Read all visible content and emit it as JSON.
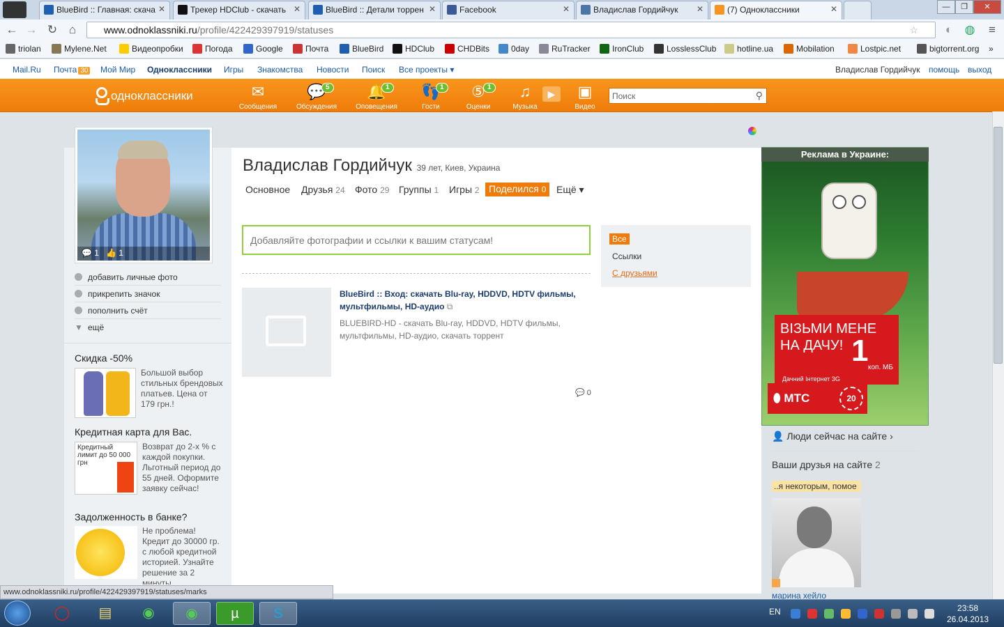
{
  "browser": {
    "tabs": [
      {
        "title": "BlueBird :: Главная: скача",
        "active": false
      },
      {
        "title": "Трекер HDClub - скачать",
        "active": false
      },
      {
        "title": "BlueBird :: Детали торрен",
        "active": false
      },
      {
        "title": "Facebook",
        "active": false
      },
      {
        "title": "Владислав Гордийчук",
        "active": false
      },
      {
        "title": "(7) Одноклассники",
        "active": true
      }
    ],
    "url_host": "www.odnoklassniki.ru",
    "url_path": "/profile/422429397919/statuses",
    "bookmarks": [
      "triolan",
      "Mylene.Net",
      "Видеопробки",
      "Погода",
      "Google",
      "Почта",
      "BlueBird",
      "HDClub",
      "CHDBits",
      "0day",
      "RuTracker",
      "IronClub",
      "LosslessClub",
      "hotline.ua",
      "Mobilation",
      "Lostpic.net",
      "bigtorrent.org"
    ],
    "status_url": "www.odnoklassniki.ru/profile/422429397919/statuses/marks"
  },
  "mailbar": {
    "links": [
      "Mail.Ru",
      "Почта",
      "Мой Мир",
      "Одноклассники",
      "Игры",
      "Знакомства",
      "Новости",
      "Поиск",
      "Все проекты"
    ],
    "mail_count": "30",
    "user": "Владислав Гордийчук",
    "help": "помощь",
    "logout": "выход"
  },
  "okbar": {
    "logo": "одноклассники",
    "nav": [
      {
        "label": "Сообщения",
        "count": "",
        "icon": "envelope-icon"
      },
      {
        "label": "Обсуждения",
        "count": "5",
        "icon": "chat-icon"
      },
      {
        "label": "Оповещения",
        "count": "1",
        "icon": "bell-icon"
      },
      {
        "label": "Гости",
        "count": "1",
        "icon": "footprints-icon"
      },
      {
        "label": "Оценки",
        "count": "1",
        "icon": "rating-icon"
      },
      {
        "label": "Музыка",
        "count": "",
        "icon": "music-icon"
      },
      {
        "label": "Видео",
        "count": "",
        "icon": "video-icon"
      }
    ],
    "search_placeholder": "Поиск"
  },
  "profile": {
    "name": "Владислав Гордийчук",
    "meta": "39 лет, Киев, Украина",
    "avatar_comments": "1",
    "avatar_likes": "1",
    "tabs": [
      {
        "label": "Основное",
        "count": ""
      },
      {
        "label": "Друзья",
        "count": "24"
      },
      {
        "label": "Фото",
        "count": "29"
      },
      {
        "label": "Группы",
        "count": "1"
      },
      {
        "label": "Игры",
        "count": "2"
      },
      {
        "label": "Поделился",
        "count": "0"
      },
      {
        "label": "Ещё ▾",
        "count": ""
      }
    ],
    "left_menu": [
      "добавить личные фото",
      "прикрепить значок",
      "пополнить счёт",
      "ещё"
    ]
  },
  "ads": [
    {
      "title": "Скидка -50%",
      "text": "Большой выбор стильных брендовых платьев. Цена от 179 грн.!"
    },
    {
      "title": "Кредитная карта для Вас.",
      "text": "Возврат до 2-х % с каждой покупки. Льготный период до 55 дней. Оформите заявку сейчас!",
      "image_text": "Кредитный лимит до 50 000 грн"
    },
    {
      "title": "Задолженность в банке?",
      "text": "Не проблема! Кредит до 30000 гр. с любой кредитной историей. Узнайте решение за 2 минуты"
    }
  ],
  "statuses": {
    "prompt": "Добавляйте фотографии и ссылки к вашим статусам!",
    "post_title": "BlueBird :: Вход: скачать Blu-ray, HDDVD, HDTV фильмы, мультфильмы, HD-аудио",
    "post_desc": "BLUEBIRD-HD - скачать Blu-ray, HDDVD, HDTV фильмы, мультфильмы, HD-аудио, скачать торрент",
    "comments": "0",
    "filters": [
      "Все",
      "Ссылки",
      "С друзьями"
    ]
  },
  "right": {
    "ad_header": "Реклама в Украине:",
    "banner_line1": "ВІЗЬМИ МЕНЕ",
    "banner_line2": "НА ДАЧУ!",
    "banner_small": "Дачний Інтернет 3G",
    "banner_big": "1",
    "banner_unit": "коп. МБ",
    "brand": "МТС",
    "brand_ring": "20",
    "online": "Люди сейчас на сайте ›",
    "friends_head": "Ваши друзья на сайте",
    "friends_count": "2",
    "friend_status": "..я некоторым, помое",
    "friend_name": "марина хейло"
  },
  "taskbar": {
    "lang": "EN",
    "time": "23:58",
    "date": "26.04.2013"
  }
}
